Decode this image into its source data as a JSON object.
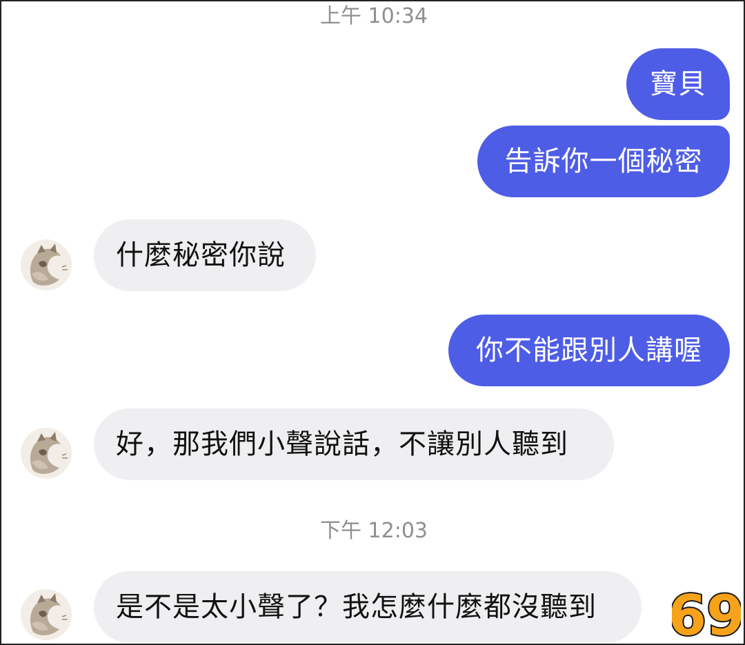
{
  "timestamps": {
    "first": "上午 10:34",
    "second": "下午 12:03"
  },
  "messages": {
    "m1": "寶貝",
    "m2": "告訴你一個秘密",
    "m3": "什麼秘密你說",
    "m4": "你不能跟別人講喔",
    "m5": "好，那我們小聲說話，不讓別人聽到",
    "m6": "是不是太小聲了？我怎麼什麼都沒聽到"
  },
  "badge": {
    "text": "69"
  },
  "colors": {
    "outgoing_bubble": "#4e5de6",
    "incoming_bubble": "#efeff1",
    "timestamp_text": "#8e8e93",
    "badge_fill": "#f7a21b"
  }
}
